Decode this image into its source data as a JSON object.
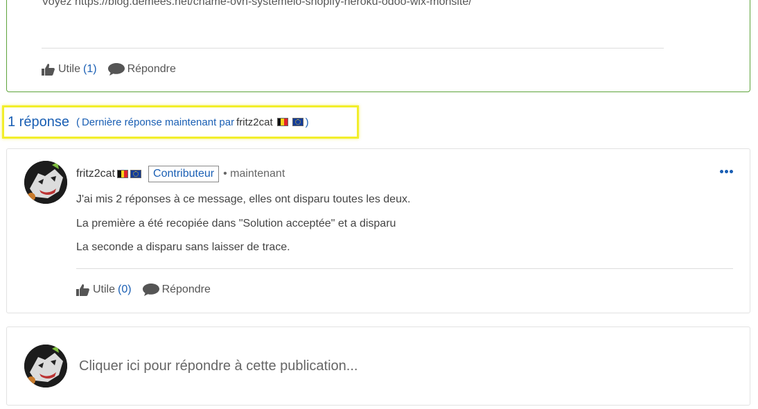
{
  "previous_post": {
    "text": "Voyez https://blog.demees.net/chame-ovh-systemeio-shopify-heroku-odoo-wix-monsite/",
    "helpful_label": "Utile",
    "helpful_count": "(1)",
    "reply_label": "Répondre"
  },
  "replies_header": {
    "count_label": "1 réponse",
    "open_paren": "(",
    "last_reply_label": "Dernière réponse maintenant par",
    "last_reply_author": "fritz2cat",
    "close_paren": ")"
  },
  "reply": {
    "author": "fritz2cat",
    "badge": "Contributeur",
    "timestamp": "• maintenant",
    "lines": [
      "J'ai mis 2 réponses à ce message, elles ont disparu toutes les deux.",
      "La première a été recopiée dans \"Solution acceptée\" et a disparu",
      "La seconde a disparu sans laisser de trace."
    ],
    "helpful_label": "Utile",
    "helpful_count": "(0)",
    "reply_label": "Répondre"
  },
  "compose": {
    "placeholder": "Cliquer ici pour répondre à cette publication..."
  },
  "icons": [
    "thumbs-up-icon",
    "speech-bubble-icon",
    "more-options-icon",
    "flag-belgium-icon",
    "flag-eu-icon",
    "avatar"
  ],
  "colors": {
    "link_blue": "#1a5fb4",
    "accepted_border": "#5da33a",
    "highlight_yellow": "#f2ee2b"
  }
}
